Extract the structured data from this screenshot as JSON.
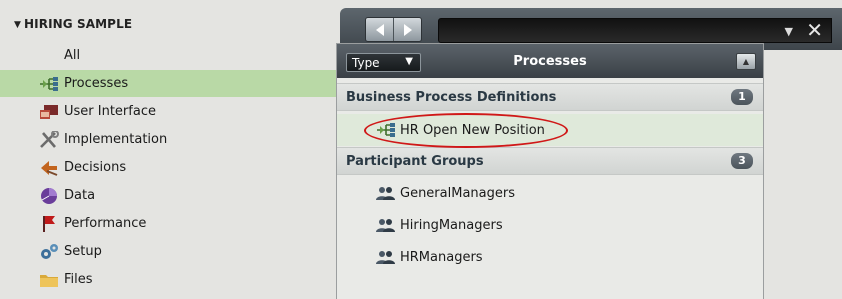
{
  "sidebar": {
    "section_title": "HIRING SAMPLE",
    "items": [
      {
        "label": "All",
        "icon": "none"
      },
      {
        "label": "Processes",
        "icon": "process-icon"
      },
      {
        "label": "User Interface",
        "icon": "user-interface-icon"
      },
      {
        "label": "Implementation",
        "icon": "implementation-icon"
      },
      {
        "label": "Decisions",
        "icon": "decisions-icon"
      },
      {
        "label": "Data",
        "icon": "data-icon"
      },
      {
        "label": "Performance",
        "icon": "performance-flag-icon"
      },
      {
        "label": "Setup",
        "icon": "setup-gear-icon"
      },
      {
        "label": "Files",
        "icon": "folder-icon"
      }
    ],
    "selected": "Processes"
  },
  "panel": {
    "type_label": "Type",
    "title": "Processes",
    "groups": [
      {
        "title": "Business Process Definitions",
        "count": "1",
        "items": [
          {
            "label": "HR Open New Position",
            "icon": "process-icon"
          }
        ]
      },
      {
        "title": "Participant Groups",
        "count": "3",
        "items": [
          {
            "label": "GeneralManagers",
            "icon": "group-icon"
          },
          {
            "label": "HiringManagers",
            "icon": "group-icon"
          },
          {
            "label": "HRManagers",
            "icon": "group-icon"
          }
        ]
      }
    ]
  },
  "colors": {
    "selected_bg": "#b9d9a6",
    "highlight_ring": "#d01818",
    "header_dark": "#3e454b",
    "group_title": "#2a3944"
  }
}
